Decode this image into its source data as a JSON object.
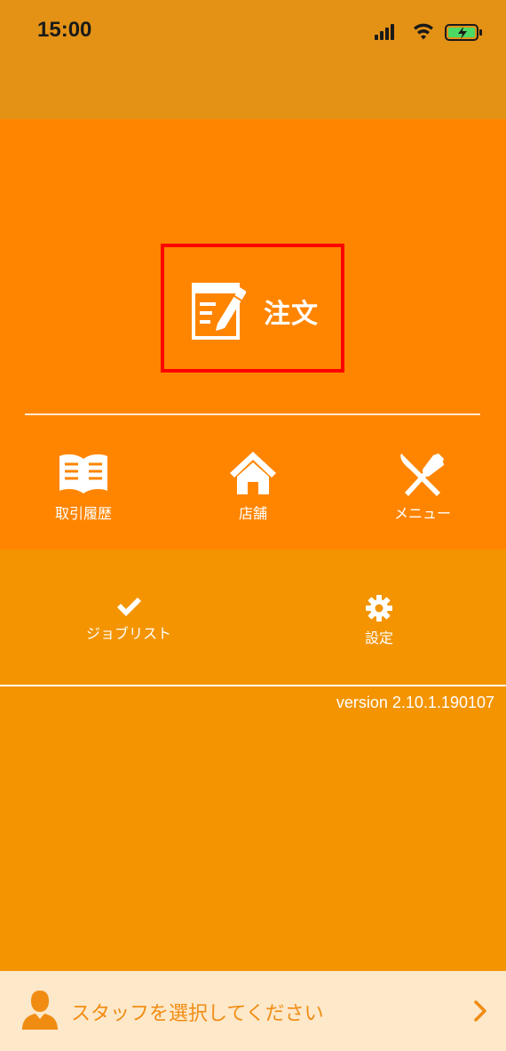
{
  "status": {
    "time": "15:00"
  },
  "order": {
    "label": "注文"
  },
  "nav": {
    "history": "取引履歴",
    "store": "店舗",
    "menu": "メニュー"
  },
  "sub": {
    "joblist": "ジョブリスト",
    "settings": "設定"
  },
  "version": "version 2.10.1.190107",
  "staff": {
    "label": "スタッフを選択してください"
  },
  "colors": {
    "header": "#e39216",
    "main": "#ff8500",
    "sub": "#f39400",
    "staff_bar": "#fde8ca",
    "staff_text": "#f08c12",
    "highlight": "#ff0000"
  }
}
